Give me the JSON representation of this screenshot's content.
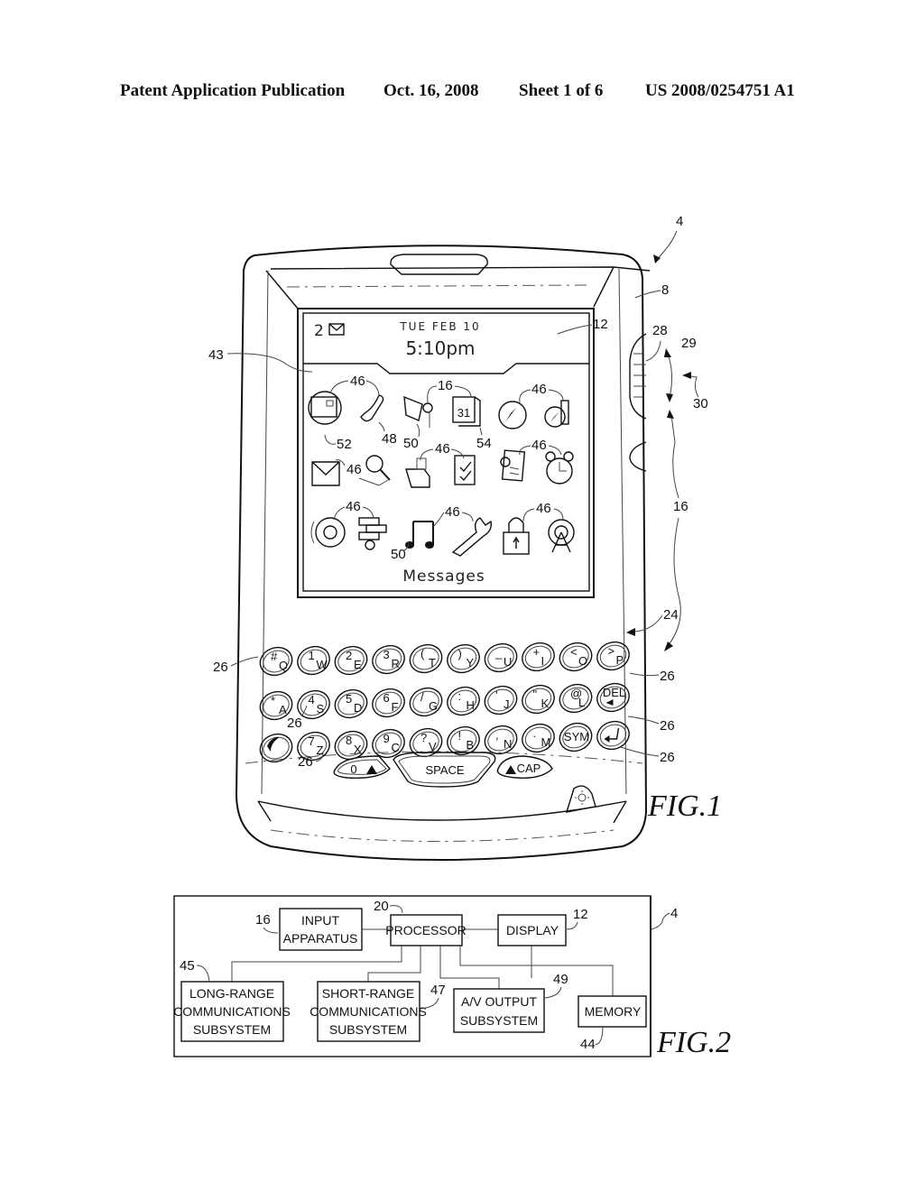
{
  "header": {
    "left": "Patent Application Publication",
    "date": "Oct. 16, 2008",
    "sheet": "Sheet 1 of 6",
    "number": "US 2008/0254751 A1"
  },
  "fig1": {
    "caption": "FIG.1",
    "screen": {
      "message_count": "2",
      "date": "TUE FEB 10",
      "time": "5:10pm",
      "selected_label": "Messages",
      "icons": [
        [
          "messages",
          "phone",
          "camera",
          "calendar",
          "browser",
          "maps"
        ],
        [
          "mail-envelope",
          "search",
          "folder",
          "tasks",
          "memo",
          "alarm"
        ],
        [
          "speaker",
          "bricks-game",
          "music",
          "tools",
          "lock",
          "signal-tower"
        ]
      ],
      "calendar_day": "31"
    },
    "keyboard": {
      "rows": [
        [
          [
            "#",
            "Q"
          ],
          [
            "1",
            "W"
          ],
          [
            "2",
            "E"
          ],
          [
            "3",
            "R"
          ],
          [
            "(",
            "T"
          ],
          [
            ")",
            "Y"
          ],
          [
            "_",
            "U"
          ],
          [
            "+",
            "I"
          ],
          [
            "<",
            "O"
          ],
          [
            ">",
            "P"
          ]
        ],
        [
          [
            "*",
            "A"
          ],
          [
            "4",
            "S"
          ],
          [
            "5",
            "D"
          ],
          [
            "6",
            "F"
          ],
          [
            "/",
            "G"
          ],
          [
            ":",
            "H"
          ],
          [
            "'",
            "J"
          ],
          [
            "\"",
            "K"
          ],
          [
            "@",
            "L"
          ],
          [
            "DEL",
            ""
          ]
        ],
        [
          [
            "",
            ""
          ],
          [
            "7",
            "Z"
          ],
          [
            "8",
            "X"
          ],
          [
            "9",
            "C"
          ],
          [
            "?",
            "V"
          ],
          [
            "!",
            "B"
          ],
          [
            ",",
            "N"
          ],
          [
            ".",
            "M"
          ],
          [
            "SYM",
            ""
          ],
          [
            "",
            ""
          ]
        ]
      ],
      "bottom": {
        "alt": "0",
        "space": "SPACE",
        "cap": "CAP"
      }
    },
    "refs": {
      "device": "4",
      "housing": "8",
      "display": "12",
      "input": "16",
      "keypad": "24",
      "keys": "26",
      "wheel": "28",
      "rotate": "29",
      "press": "30",
      "screen_area": "43",
      "icons": "46",
      "phone_icon": "48",
      "icon_50": "50",
      "icon_52": "52",
      "icon_54": "54"
    }
  },
  "fig2": {
    "caption": "FIG.2",
    "ref_device": "4",
    "blocks": {
      "input": {
        "lines": [
          "INPUT",
          "APPARATUS"
        ],
        "ref": "16"
      },
      "processor": {
        "lines": [
          "PROCESSOR"
        ],
        "ref": "20"
      },
      "display": {
        "lines": [
          "DISPLAY"
        ],
        "ref": "12"
      },
      "long_range": {
        "lines": [
          "LONG-RANGE",
          "COMMUNICATIONS",
          "SUBSYSTEM"
        ],
        "ref": "45"
      },
      "short_range": {
        "lines": [
          "SHORT-RANGE",
          "COMMUNICATIONS",
          "SUBSYSTEM"
        ],
        "ref": "47"
      },
      "av_output": {
        "lines": [
          "A/V OUTPUT",
          "SUBSYSTEM"
        ],
        "ref": "49"
      },
      "memory": {
        "lines": [
          "MEMORY"
        ],
        "ref": "44"
      }
    }
  }
}
